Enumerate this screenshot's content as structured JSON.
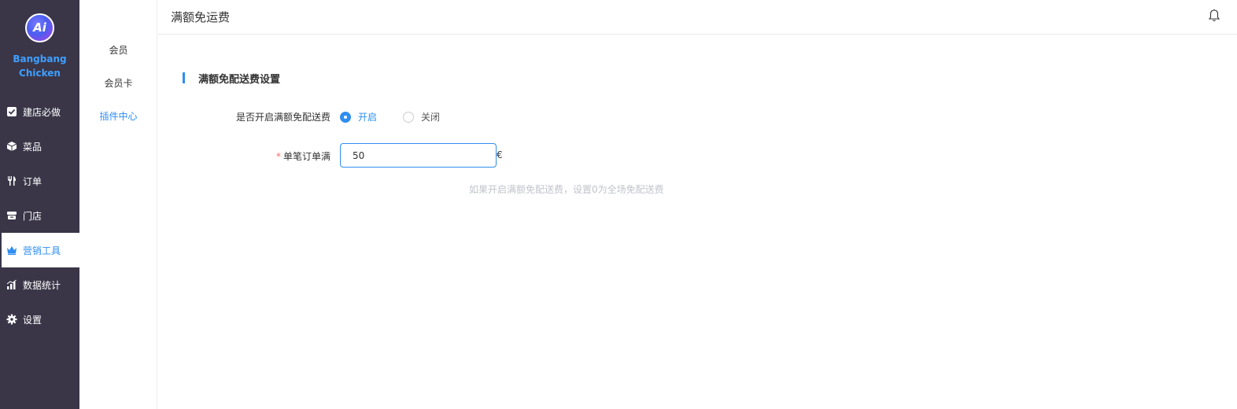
{
  "brand": {
    "logo_text": "Ai",
    "name_line1": "Bangbang",
    "name_line2": "Chicken"
  },
  "nav": {
    "items": [
      {
        "label": "建店必做",
        "icon": "checkbox-icon",
        "active": false
      },
      {
        "label": "菜品",
        "icon": "box-icon",
        "active": false
      },
      {
        "label": "订单",
        "icon": "cutlery-icon",
        "active": false
      },
      {
        "label": "门店",
        "icon": "store-icon",
        "active": false
      },
      {
        "label": "营销工具",
        "icon": "crown-icon",
        "active": true
      },
      {
        "label": "数据统计",
        "icon": "chart-icon",
        "active": false
      },
      {
        "label": "设置",
        "icon": "gear-icon",
        "active": false
      }
    ]
  },
  "submenu": {
    "items": [
      {
        "label": "会员",
        "active": false
      },
      {
        "label": "会员卡",
        "active": false
      },
      {
        "label": "插件中心",
        "active": true
      }
    ]
  },
  "header": {
    "title": "满额免运费",
    "bell_icon": "bell-icon"
  },
  "form": {
    "section_title": "满额免配送费设置",
    "enable_label": "是否开启满额免配送费",
    "radio_on_label": "开启",
    "radio_off_label": "关闭",
    "selected": "开启",
    "threshold_required_mark": "*",
    "threshold_label": "单笔订单满",
    "threshold_value": "50",
    "currency": "€",
    "hint": "如果开启满额免配送费，设置0为全场免配送费"
  },
  "colors": {
    "sidebar_bg": "#3a3648",
    "accent": "#2f8ef0",
    "brand_text": "#3f9fff"
  }
}
